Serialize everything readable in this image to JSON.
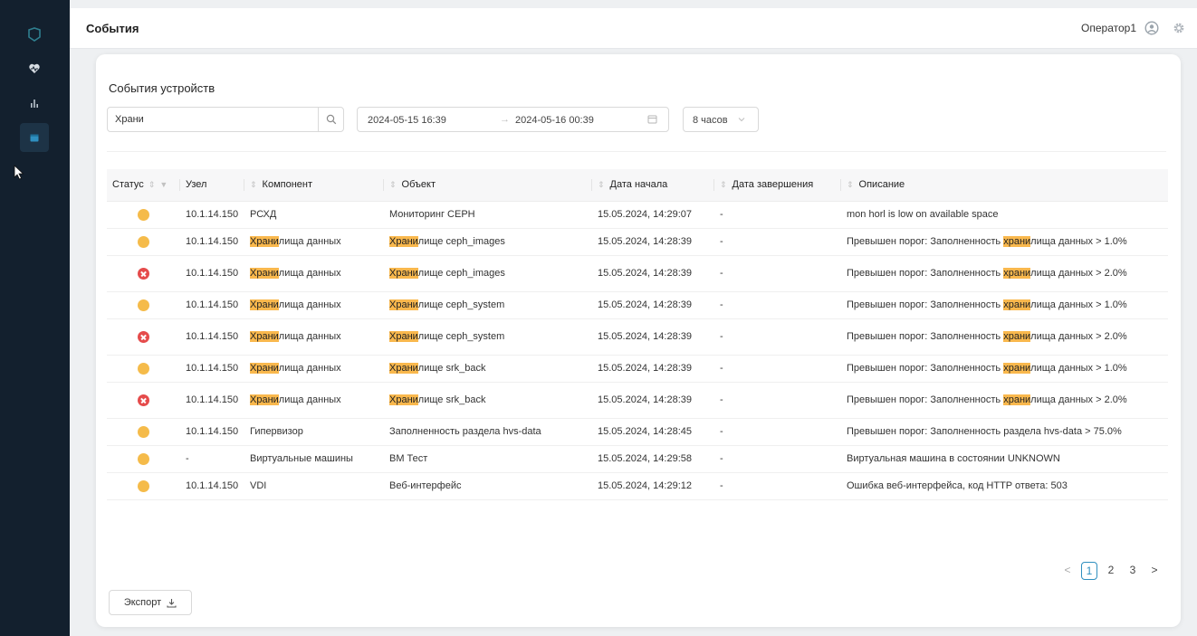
{
  "header": {
    "title": "События",
    "user": "Оператор1"
  },
  "card": {
    "title": "События устройств"
  },
  "filters": {
    "search_value": "Храни",
    "date_start": "2024-05-15 16:39",
    "date_arrow": "→",
    "date_end": "2024-05-16 00:39",
    "period": "8 часов"
  },
  "table": {
    "columns": [
      "Статус",
      "Узел",
      "Компонент",
      "Объект",
      "Дата начала",
      "Дата завершения",
      "Описание"
    ],
    "rows": [
      {
        "status": "warning",
        "node": "10.1.14.150",
        "comp_hl": "",
        "comp_rest": "РСХД",
        "obj_hl": "",
        "obj_rest": "Мониторинг CEPH",
        "start": "15.05.2024, 14:29:07",
        "end": "-",
        "desc_pre": "mon horl is low on available space",
        "desc_hl": "",
        "desc_post": ""
      },
      {
        "status": "warning",
        "node": "10.1.14.150",
        "comp_hl": "Храни",
        "comp_rest": "лища данных",
        "obj_hl": "Храни",
        "obj_rest": "лище ceph_images",
        "start": "15.05.2024, 14:28:39",
        "end": "-",
        "desc_pre": "Превышен порог: Заполненность ",
        "desc_hl": "храни",
        "desc_post": "лища данных > 1.0%"
      },
      {
        "status": "error",
        "node": "10.1.14.150",
        "comp_hl": "Храни",
        "comp_rest": "лища данных",
        "obj_hl": "Храни",
        "obj_rest": "лище ceph_images",
        "start": "15.05.2024, 14:28:39",
        "end": "-",
        "desc_pre": "Превышен порог: Заполненность ",
        "desc_hl": "храни",
        "desc_post": "лища данных > 2.0%"
      },
      {
        "status": "warning",
        "node": "10.1.14.150",
        "comp_hl": "Храни",
        "comp_rest": "лища данных",
        "obj_hl": "Храни",
        "obj_rest": "лище ceph_system",
        "start": "15.05.2024, 14:28:39",
        "end": "-",
        "desc_pre": "Превышен порог: Заполненность ",
        "desc_hl": "храни",
        "desc_post": "лища данных > 1.0%"
      },
      {
        "status": "error",
        "node": "10.1.14.150",
        "comp_hl": "Храни",
        "comp_rest": "лища данных",
        "obj_hl": "Храни",
        "obj_rest": "лище ceph_system",
        "start": "15.05.2024, 14:28:39",
        "end": "-",
        "desc_pre": "Превышен порог: Заполненность ",
        "desc_hl": "храни",
        "desc_post": "лища данных > 2.0%"
      },
      {
        "status": "warning",
        "node": "10.1.14.150",
        "comp_hl": "Храни",
        "comp_rest": "лища данных",
        "obj_hl": "Храни",
        "obj_rest": "лище srk_back",
        "start": "15.05.2024, 14:28:39",
        "end": "-",
        "desc_pre": "Превышен порог: Заполненность ",
        "desc_hl": "храни",
        "desc_post": "лища данных > 1.0%"
      },
      {
        "status": "error",
        "node": "10.1.14.150",
        "comp_hl": "Храни",
        "comp_rest": "лища данных",
        "obj_hl": "Храни",
        "obj_rest": "лище srk_back",
        "start": "15.05.2024, 14:28:39",
        "end": "-",
        "desc_pre": "Превышен порог: Заполненность ",
        "desc_hl": "храни",
        "desc_post": "лища данных > 2.0%"
      },
      {
        "status": "warning",
        "node": "10.1.14.150",
        "comp_hl": "",
        "comp_rest": "Гипервизор",
        "obj_hl": "",
        "obj_rest": "Заполненность раздела hvs-data",
        "start": "15.05.2024, 14:28:45",
        "end": "-",
        "desc_pre": "Превышен порог: Заполненность раздела hvs-data > 75.0%",
        "desc_hl": "",
        "desc_post": ""
      },
      {
        "status": "warning",
        "node": "-",
        "comp_hl": "",
        "comp_rest": "Виртуальные машины",
        "obj_hl": "",
        "obj_rest": "ВМ Тест",
        "start": "15.05.2024, 14:29:58",
        "end": "-",
        "desc_pre": "Виртуальная машина в состоянии UNKNOWN",
        "desc_hl": "",
        "desc_post": ""
      },
      {
        "status": "warning",
        "node": "10.1.14.150",
        "comp_hl": "",
        "comp_rest": "VDI",
        "obj_hl": "",
        "obj_rest": "Веб-интерфейс",
        "start": "15.05.2024, 14:29:12",
        "end": "-",
        "desc_pre": "Ошибка веб-интерфейса, код HTTP ответа: 503",
        "desc_hl": "",
        "desc_post": ""
      }
    ]
  },
  "pagination": {
    "prev": "<",
    "pages": [
      "1",
      "2",
      "3"
    ],
    "current": "1",
    "next": ">"
  },
  "export_label": "Экспорт",
  "colors": {
    "sidebar": "#13202e",
    "warning": "#f5bb4a",
    "error": "#e54b4b",
    "highlight": "#f9b84d",
    "accent": "#2f8fbf"
  },
  "icons": {
    "sidebar": [
      "logo-icon",
      "heart-monitor-icon",
      "bar-chart-icon",
      "calendar-icon"
    ],
    "header": [
      "user-avatar-icon",
      "gear-icon"
    ],
    "filters": [
      "search-icon",
      "calendar-icon",
      "chevron-down-icon"
    ],
    "export": "download-icon"
  }
}
